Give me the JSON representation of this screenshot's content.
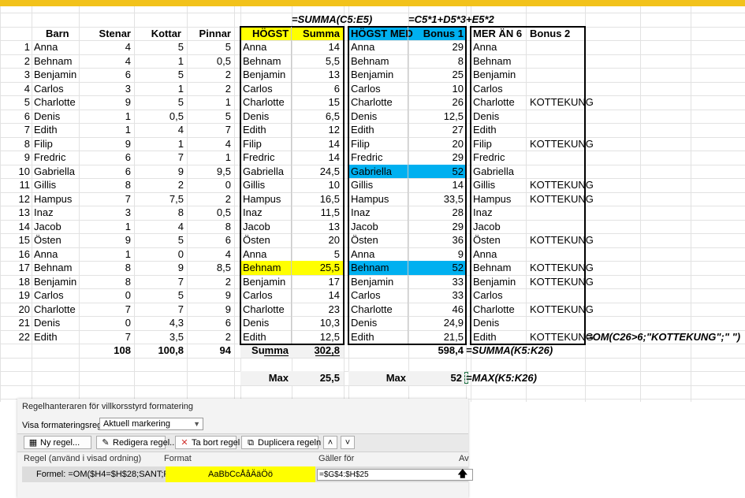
{
  "formulas": {
    "sum_header": "=SUMMA(C5:E5)",
    "bonus1_header": "=C5*1+D5*3+E5*2",
    "bonus2_side": "=OM(C26>6;\"KOTTEKUNG\";\" \")",
    "sum_side": "=SUMMA(K5:K26)",
    "max_side": "=MAX(K5:K26)"
  },
  "headers": {
    "barn": "Barn",
    "stenar": "Stenar",
    "kottar": "Kottar",
    "pinnar": "Pinnar",
    "hogst": "HÖGST",
    "summa": "Summa",
    "hogst_med": "HÖGST MED",
    "bonus1": "Bonus 1",
    "mer_an_6": "MER ÄN 6",
    "bonus2": "Bonus 2"
  },
  "rows": [
    {
      "nr": "1",
      "name": "Anna",
      "stenar": "4",
      "kottar": "5",
      "pinnar": "5",
      "summa": "14",
      "bonus1": "29",
      "bonus2": ""
    },
    {
      "nr": "2",
      "name": "Behnam",
      "stenar": "4",
      "kottar": "1",
      "pinnar": "0,5",
      "summa": "5,5",
      "bonus1": "8",
      "bonus2": ""
    },
    {
      "nr": "3",
      "name": "Benjamin",
      "stenar": "6",
      "kottar": "5",
      "pinnar": "2",
      "summa": "13",
      "bonus1": "25",
      "bonus2": ""
    },
    {
      "nr": "4",
      "name": "Carlos",
      "stenar": "3",
      "kottar": "1",
      "pinnar": "2",
      "summa": "6",
      "bonus1": "10",
      "bonus2": ""
    },
    {
      "nr": "5",
      "name": "Charlotte",
      "stenar": "9",
      "kottar": "5",
      "pinnar": "1",
      "summa": "15",
      "bonus1": "26",
      "bonus2": "KOTTEKUNG"
    },
    {
      "nr": "6",
      "name": "Denis",
      "stenar": "1",
      "kottar": "0,5",
      "pinnar": "5",
      "summa": "6,5",
      "bonus1": "12,5",
      "bonus2": ""
    },
    {
      "nr": "7",
      "name": "Edith",
      "stenar": "1",
      "kottar": "4",
      "pinnar": "7",
      "summa": "12",
      "bonus1": "27",
      "bonus2": ""
    },
    {
      "nr": "8",
      "name": "Filip",
      "stenar": "9",
      "kottar": "1",
      "pinnar": "4",
      "summa": "14",
      "bonus1": "20",
      "bonus2": "KOTTEKUNG"
    },
    {
      "nr": "9",
      "name": "Fredric",
      "stenar": "6",
      "kottar": "7",
      "pinnar": "1",
      "summa": "14",
      "bonus1": "29",
      "bonus2": ""
    },
    {
      "nr": "10",
      "name": "Gabriella",
      "stenar": "6",
      "kottar": "9",
      "pinnar": "9,5",
      "summa": "24,5",
      "bonus1": "52",
      "bonus2": ""
    },
    {
      "nr": "11",
      "name": "Gillis",
      "stenar": "8",
      "kottar": "2",
      "pinnar": "0",
      "summa": "10",
      "bonus1": "14",
      "bonus2": "KOTTEKUNG"
    },
    {
      "nr": "12",
      "name": "Hampus",
      "stenar": "7",
      "kottar": "7,5",
      "pinnar": "2",
      "summa": "16,5",
      "bonus1": "33,5",
      "bonus2": "KOTTEKUNG"
    },
    {
      "nr": "13",
      "name": "Inaz",
      "stenar": "3",
      "kottar": "8",
      "pinnar": "0,5",
      "summa": "11,5",
      "bonus1": "28",
      "bonus2": ""
    },
    {
      "nr": "14",
      "name": "Jacob",
      "stenar": "1",
      "kottar": "4",
      "pinnar": "8",
      "summa": "13",
      "bonus1": "29",
      "bonus2": ""
    },
    {
      "nr": "15",
      "name": "Östen",
      "stenar": "9",
      "kottar": "5",
      "pinnar": "6",
      "summa": "20",
      "bonus1": "36",
      "bonus2": "KOTTEKUNG"
    },
    {
      "nr": "16",
      "name": "Anna",
      "stenar": "1",
      "kottar": "0",
      "pinnar": "4",
      "summa": "5",
      "bonus1": "9",
      "bonus2": ""
    },
    {
      "nr": "17",
      "name": "Behnam",
      "stenar": "8",
      "kottar": "9",
      "pinnar": "8,5",
      "summa": "25,5",
      "bonus1": "52",
      "bonus2": "KOTTEKUNG"
    },
    {
      "nr": "18",
      "name": "Benjamin",
      "stenar": "8",
      "kottar": "7",
      "pinnar": "2",
      "summa": "17",
      "bonus1": "33",
      "bonus2": "KOTTEKUNG"
    },
    {
      "nr": "19",
      "name": "Carlos",
      "stenar": "0",
      "kottar": "5",
      "pinnar": "9",
      "summa": "14",
      "bonus1": "33",
      "bonus2": ""
    },
    {
      "nr": "20",
      "name": "Charlotte",
      "stenar": "7",
      "kottar": "7",
      "pinnar": "9",
      "summa": "23",
      "bonus1": "46",
      "bonus2": "KOTTEKUNG"
    },
    {
      "nr": "21",
      "name": "Denis",
      "stenar": "0",
      "kottar": "4,3",
      "pinnar": "6",
      "summa": "10,3",
      "bonus1": "24,9",
      "bonus2": ""
    },
    {
      "nr": "22",
      "name": "Edith",
      "stenar": "7",
      "kottar": "3,5",
      "pinnar": "2",
      "summa": "12,5",
      "bonus1": "21,5",
      "bonus2": "KOTTEKUNG"
    }
  ],
  "highlights": {
    "yellow_rows": [
      17
    ],
    "blue_rows": [
      10,
      17
    ],
    "yellow": "#ffff00",
    "blue": "#00b0f0"
  },
  "totals": {
    "stenar": "108",
    "kottar": "100,8",
    "pinnar": "94",
    "summa_label": "Summa",
    "summa_value": "302,8",
    "bonus1_total": "598,4"
  },
  "max_row": {
    "label_1": "Max",
    "value_1": "25,5",
    "label_2": "Max",
    "value_2": "52"
  },
  "dialog": {
    "title": "Regelhanteraren för villkorsstyrd formatering",
    "show_label": "Visa formateringsregler för:",
    "show_value": "Aktuell markering",
    "buttons": {
      "new": "Ny regel...",
      "edit": "Redigera regel...",
      "delete": "Ta bort regel",
      "duplicate": "Duplicera regeln"
    },
    "columns": {
      "rule": "Regel (använd i visad ordning)",
      "format": "Format",
      "applies": "Gäller för",
      "stop": "Av"
    },
    "rule": {
      "name": "Formel: =OM($H4=$H$28;SANT;FALSKT)",
      "preview": "AaBbCcÅåÄäÖö",
      "applies_to": "=$G$4:$H$25"
    }
  }
}
